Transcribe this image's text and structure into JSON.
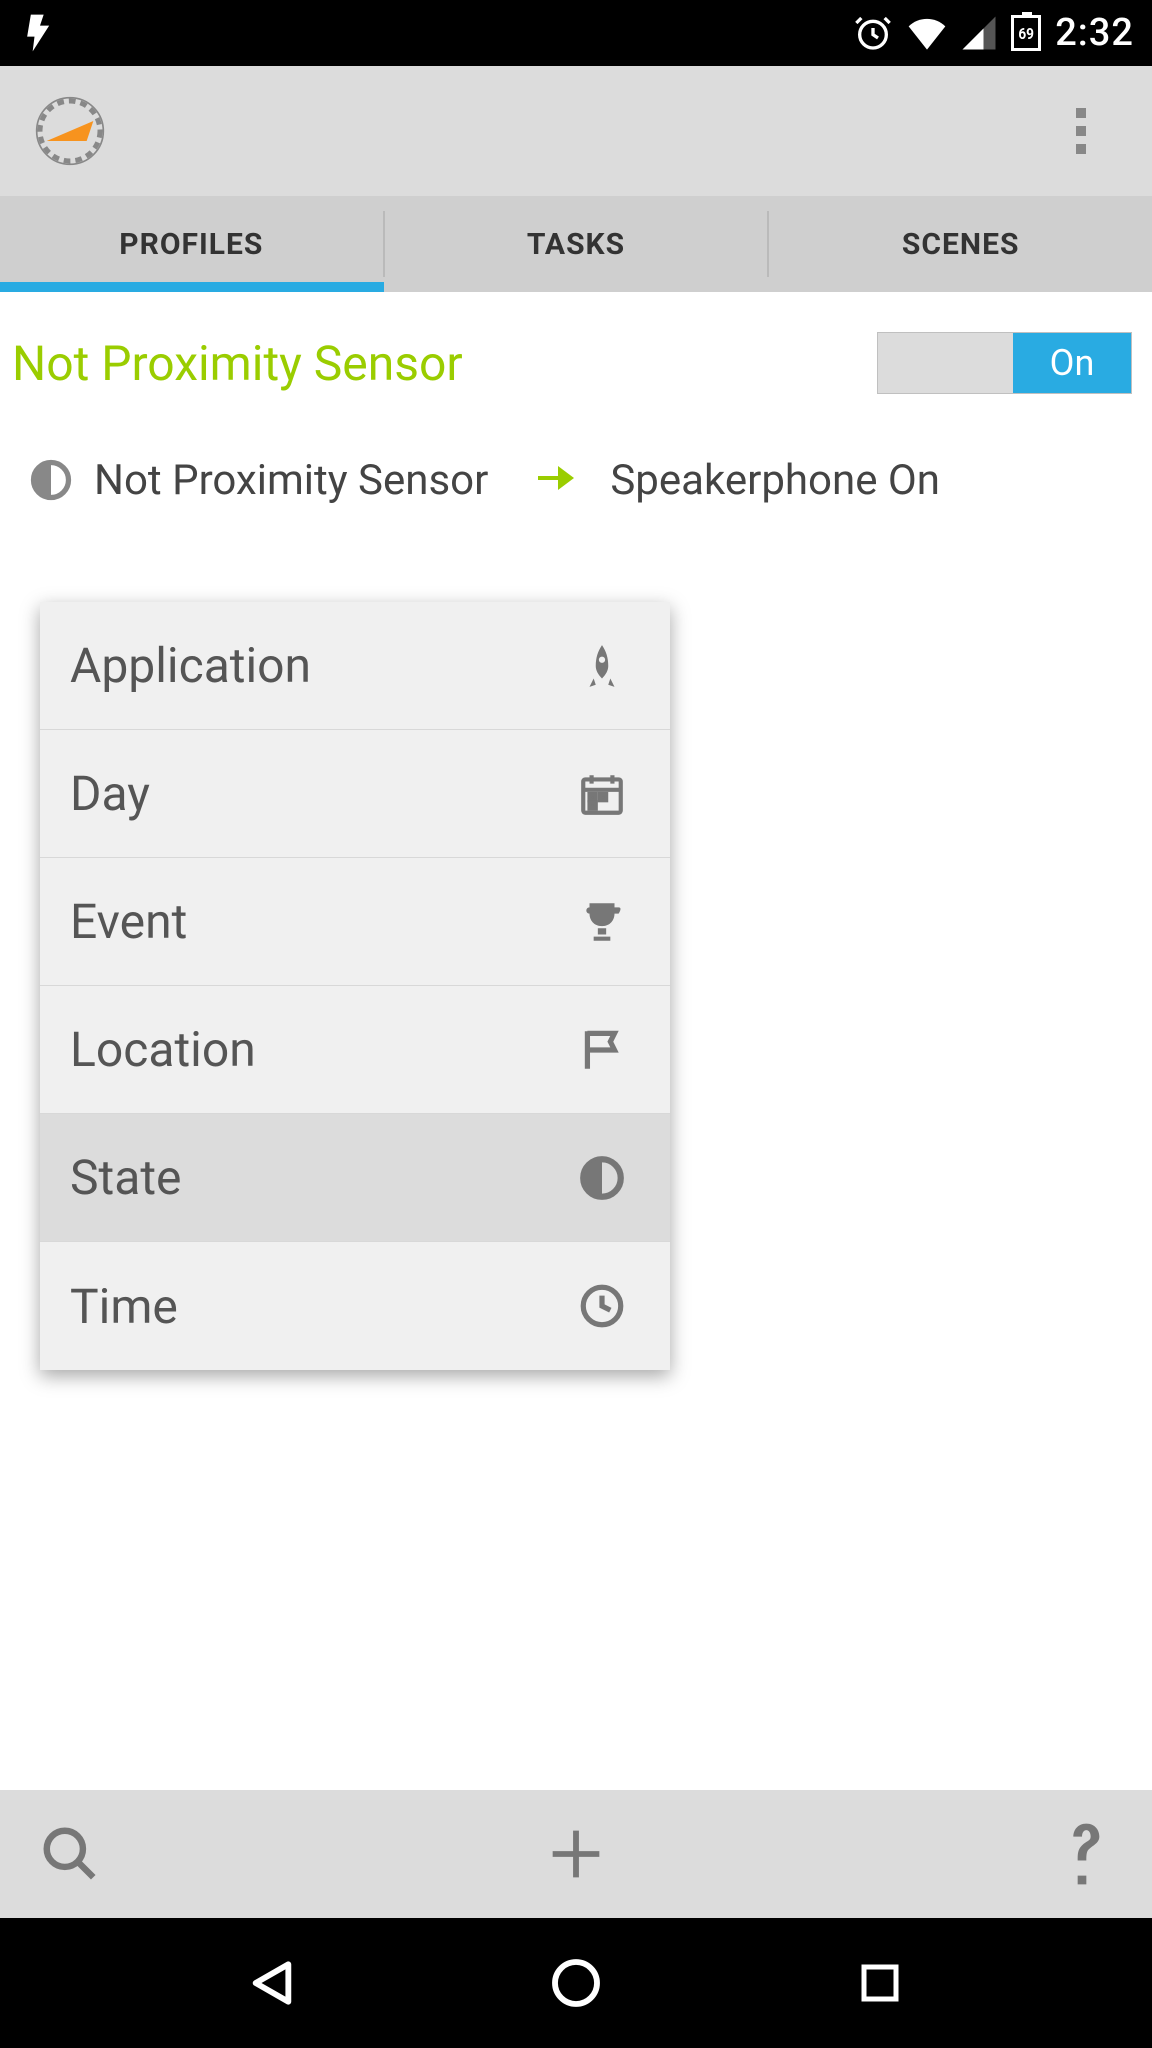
{
  "status": {
    "time": "2:32",
    "battery": "69"
  },
  "tabs": {
    "profiles": "PROFILES",
    "tasks": "TASKS",
    "scenes": "SCENES"
  },
  "profile": {
    "title": "Not Proximity Sensor",
    "toggle_on": "On",
    "condition": "Not Proximity Sensor",
    "action": "Speakerphone On"
  },
  "menu": {
    "items": [
      {
        "label": "Application",
        "icon": "rocket"
      },
      {
        "label": "Day",
        "icon": "calendar"
      },
      {
        "label": "Event",
        "icon": "trophy"
      },
      {
        "label": "Location",
        "icon": "flag"
      },
      {
        "label": "State",
        "icon": "half-circle",
        "selected": true
      },
      {
        "label": "Time",
        "icon": "clock"
      }
    ]
  }
}
